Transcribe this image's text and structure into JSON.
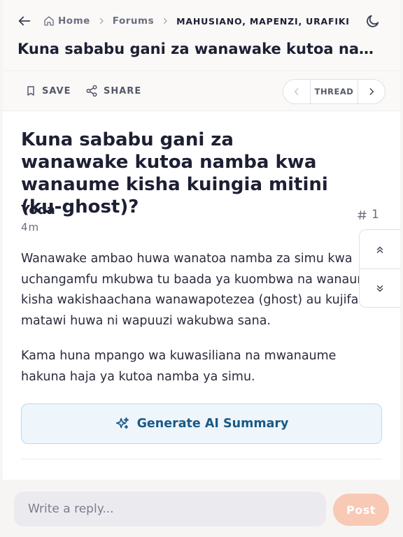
{
  "breadcrumb": {
    "home": "Home",
    "forums": "Forums",
    "current": "MAHUSIANO, MAPENZI, URAFIKI"
  },
  "header": {
    "title": "Kuna sababu gani za wanawake kutoa namba kwa wanaume kisha kuingia mitini (ku-ghost)?"
  },
  "actions": {
    "save_label": "SAVE",
    "share_label": "SHARE",
    "thread_label": "THREAD"
  },
  "post": {
    "title": "Kuna sababu gani za wanawake kutoa namba kwa wanaume kisha kuingia mitini (ku-ghost)?",
    "author": "Yoda",
    "time": "4m",
    "number": "1",
    "paragraph1_lines": [
      "Wanawake ambao huwa wanatoa namba za simu kwa",
      "uchangamfu mkubwa tu baada ya kuombwa na wanaume",
      "kisha wakishaachana wanawapotezea (ghost) au kujifanya",
      "matawi huwa ni wapuuzi wakubwa sana."
    ],
    "paragraph2": "Kama huna mpango wa kuwasiliana na mwanaume hakuna haja ya kutoa namba ya simu."
  },
  "ai": {
    "label": "Generate AI Summary"
  },
  "reply": {
    "placeholder": "Write a reply...",
    "post_label": "Post"
  },
  "colors": {
    "accent": "#f8c9b4",
    "ai_text": "#1a5a85",
    "ai_bg": "#eef6fc"
  },
  "icons": [
    "arrow-left-icon",
    "home-icon",
    "chevron-right-icon",
    "moon-icon",
    "bookmark-icon",
    "share-icon",
    "chevron-left-icon",
    "hash-icon",
    "double-chevron-up-icon",
    "double-chevron-down-icon",
    "sparkles-icon"
  ]
}
